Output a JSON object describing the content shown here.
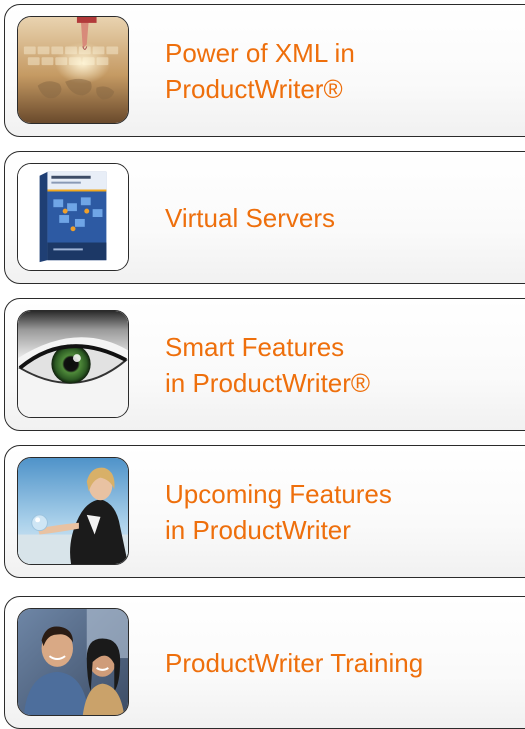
{
  "cards": [
    {
      "lines": [
        "Power of XML in",
        "ProductWriter®"
      ],
      "icon": "keyboard-globe-icon"
    },
    {
      "lines": [
        "Virtual Servers"
      ],
      "icon": "software-box-icon"
    },
    {
      "lines": [
        "Smart Features",
        "in ProductWriter®"
      ],
      "icon": "eye-icon"
    },
    {
      "lines": [
        "Upcoming Features",
        "in ProductWriter"
      ],
      "icon": "businesswoman-icon"
    },
    {
      "lines": [
        "ProductWriter Training"
      ],
      "icon": "people-icon"
    }
  ],
  "colors": {
    "accent": "#ee6f0c",
    "border": "#2b2b2b"
  }
}
